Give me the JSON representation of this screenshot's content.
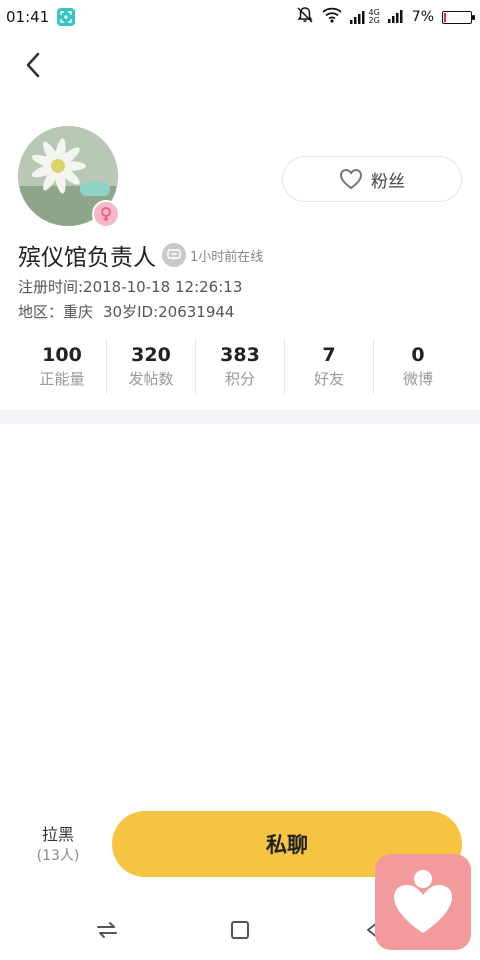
{
  "status_bar": {
    "time": "01:41",
    "battery_percent": "7%",
    "battery_level": 0.07,
    "net_top": "4G",
    "net_bottom": "2G",
    "icons": [
      "scan-app-icon",
      "bell-muted-icon",
      "wifi-icon",
      "signal-icon",
      "signal-icon",
      "battery-icon"
    ]
  },
  "header": {
    "back_icon": "back-arrow-icon"
  },
  "profile": {
    "name": "殡仪馆负责人",
    "online_status": "1小时前在线",
    "registered": "注册时间:2018-10-18 12:26:13",
    "region": "地区：重庆",
    "age_id": "30岁ID:20631944",
    "gender_icon": "female-icon",
    "fans_button": {
      "label": "粉丝",
      "icon": "heart-outline-icon"
    }
  },
  "stats": [
    {
      "value": "100",
      "label": "正能量"
    },
    {
      "value": "320",
      "label": "发帖数"
    },
    {
      "value": "383",
      "label": "积分"
    },
    {
      "value": "7",
      "label": "好友"
    },
    {
      "value": "0",
      "label": "微博"
    }
  ],
  "actions": {
    "block_label": "拉黑",
    "block_count": "(13人)",
    "chat_label": "私聊"
  },
  "colors": {
    "accent": "#f5c442",
    "floating_app": "#f29a9c",
    "badge": "#f5b8c8"
  }
}
